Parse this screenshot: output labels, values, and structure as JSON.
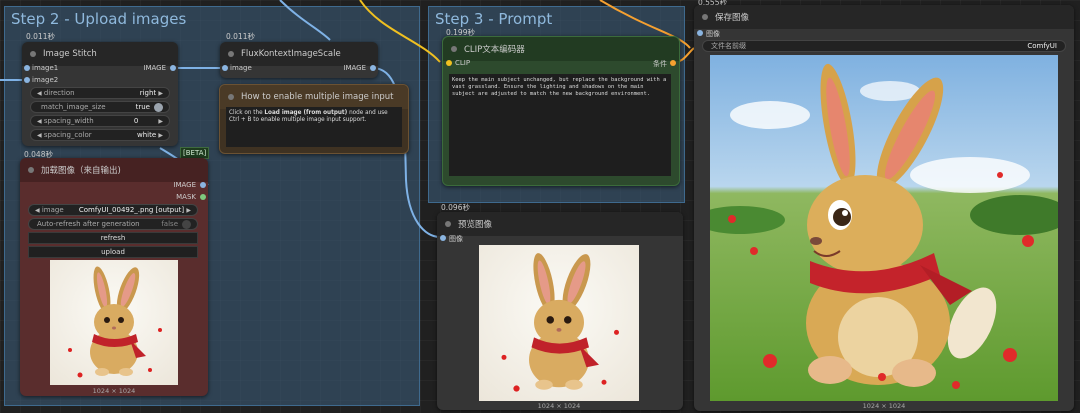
{
  "groups": {
    "upload": {
      "title": "Step 2 - Upload images"
    },
    "prompt": {
      "title": "Step 3 - Prompt"
    }
  },
  "nodes": {
    "image_stitch": {
      "time": "0.011秒",
      "title": "Image Stitch",
      "inputs": [
        "image1",
        "image2"
      ],
      "output": "IMAGE",
      "widgets": {
        "direction": {
          "label": "direction",
          "value": "right"
        },
        "match_image_size": {
          "label": "match_image_size",
          "value": "true"
        },
        "spacing_width": {
          "label": "spacing_width",
          "value": "0"
        },
        "spacing_color": {
          "label": "spacing_color",
          "value": "white"
        }
      }
    },
    "flux_scale": {
      "time": "0.011秒",
      "title": "FluxKontextImageScale",
      "input": "image",
      "output": "IMAGE"
    },
    "note": {
      "title": "How to enable multiple image input",
      "text_before": "Click on the ",
      "text_bold": "Load image (from output)",
      "text_after": " node and use Ctrl + B to enable multiple image input support."
    },
    "load_image": {
      "badge": "[BETA]",
      "time": "0.048秒",
      "title": "加载图像（来自输出)",
      "outputs": [
        "IMAGE",
        "MASK"
      ],
      "image_label": "image",
      "image_value": "ComfyUI_00492_.png [output]",
      "auto_refresh_label": "Auto-refresh after generation",
      "auto_refresh_value": "false",
      "refresh_button": "refresh",
      "upload_button": "upload",
      "caption": "1024 × 1024"
    },
    "clip": {
      "time": "0.199秒",
      "title": "CLIP文本编码器",
      "input": "CLIP",
      "output": "条件",
      "prompt": "Keep the main subject unchanged, but replace the background with a vast grassland. Ensure the lighting and shadows on the main subject are adjusted to match the new background environment."
    },
    "preview": {
      "time": "0.096秒",
      "title": "预览图像",
      "input": "图像",
      "caption": "1024 × 1024"
    },
    "save": {
      "time": "0.555秒",
      "title": "保存图像",
      "input": "图像",
      "prefix_label": "文件名前缀",
      "prefix_value": "ComfyUI",
      "caption": "1024 × 1024"
    }
  },
  "colors": {
    "group": "#3c5f7d",
    "clip_node": "#2d4a2d",
    "note_node": "#3f3222",
    "load_node": "#5a2d2d",
    "wire_image": "#7fb2e6",
    "wire_clip": "#f0c020",
    "wire_cond": "#f5a030"
  }
}
